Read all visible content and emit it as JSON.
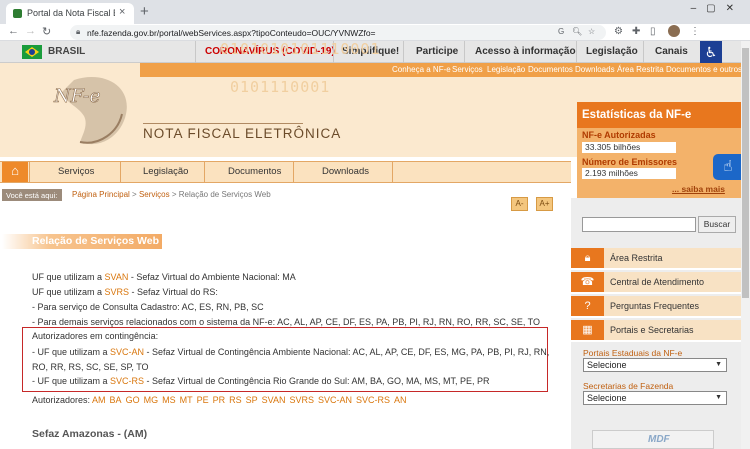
{
  "browser": {
    "tab_title": "Portal da Nota Fiscal Eletrônica",
    "url": "nfe.fazenda.gov.br/portal/webServices.aspx?tipoConteudo=OUC/YVNWZfo="
  },
  "govbar": {
    "country": "BRASIL",
    "items": [
      "CORONAVÍRUS (COVID-19)",
      "Simplifique!",
      "Participe",
      "Acesso à informação",
      "Legislação",
      "Canais"
    ]
  },
  "header": {
    "topnav": [
      "Conheça a NF-e",
      "Serviços",
      "Legislação",
      "Documentos",
      "Downloads",
      "Área Restrita",
      "Documentos e outros"
    ],
    "logo_mark": "NF-e",
    "logo_text": "NOTA FISCAL ELETRÔNICA",
    "binary_1": "0101010101110001",
    "binary_2": "0101110001"
  },
  "stats": {
    "title": "Estatísticas da NF-e",
    "authorized_label": "NF-e Autorizadas",
    "authorized_value": "33.305 bilhões",
    "issuers_label": "Número de Emissores",
    "issuers_value": "2.193 milhões",
    "more_link": "... saiba mais"
  },
  "menu": {
    "items": [
      "Serviços",
      "Legislação",
      "Documentos",
      "Downloads"
    ]
  },
  "breadcrumb": {
    "label": "Você está aqui:",
    "home": "Página Principal",
    "sep": " > ",
    "section": "Serviços",
    "current": "Relação de Serviços Web"
  },
  "font_controls": {
    "decrease": "A-",
    "increase": "A+"
  },
  "content": {
    "title": "Relação de Serviços Web",
    "svan_pre": "UF que utilizam a ",
    "svan_link": "SVAN",
    "svan_post": " - Sefaz Virtual do Ambiente Nacional: MA",
    "svrs_pre": "UF que utilizam a ",
    "svrs_link": "SVRS",
    "svrs_post": " - Sefaz Virtual do RS:",
    "svrs_line1": "- Para serviço de Consulta Cadastro: AC, ES, RN, PB, SC",
    "svrs_line2": "- Para demais serviços relacionados com o sistema da NF-e: AC, AL, AP, CE, DF, ES, PA, PB, PI, RJ, RN, RO, RR, SC, SE, TO",
    "contingency_title": "Autorizadores em contingência:",
    "svcan_pre": "- UF que utilizam a ",
    "svcan_link": "SVC-AN",
    "svcan_post": " - Sefaz Virtual de Contingência Ambiente Nacional: AC, AL, AP, CE, DF, ES, MG, PA, PB, PI, RJ, RN,",
    "svcan_cont": "RO, RR, RS, SC, SE, SP, TO",
    "svcrs_pre": "- UF que utilizam a ",
    "svcrs_link": "SVC-RS",
    "svcrs_post": " - Sefaz Virtual de Contingência Rio Grande do Sul: AM, BA, GO, MA, MS, MT, PE, PR",
    "authorizers_label": "Autorizadores:",
    "authorizers": [
      "AM",
      "BA",
      "GO",
      "MG",
      "MS",
      "MT",
      "PE",
      "PR",
      "RS",
      "SP",
      "SVAN",
      "SVRS",
      "SVC-AN",
      "SVC-RS",
      "AN"
    ],
    "next_section": "Sefaz Amazonas - (AM)"
  },
  "sidebar": {
    "search_button": "Buscar",
    "links": [
      "Área Restrita",
      "Central de Atendimento",
      "Perguntas Frequentes",
      "Portais e Secretarias"
    ],
    "portals_label": "Portais Estaduais da NF-e",
    "portals_select": "Selecione",
    "secretarias_label": "Secretarias de Fazenda",
    "secretarias_select": "Selecione",
    "banner_text": "MDF"
  },
  "colors": {
    "accent": "#e8771e",
    "link": "#d9760c",
    "highlight_box": "#c62828"
  }
}
